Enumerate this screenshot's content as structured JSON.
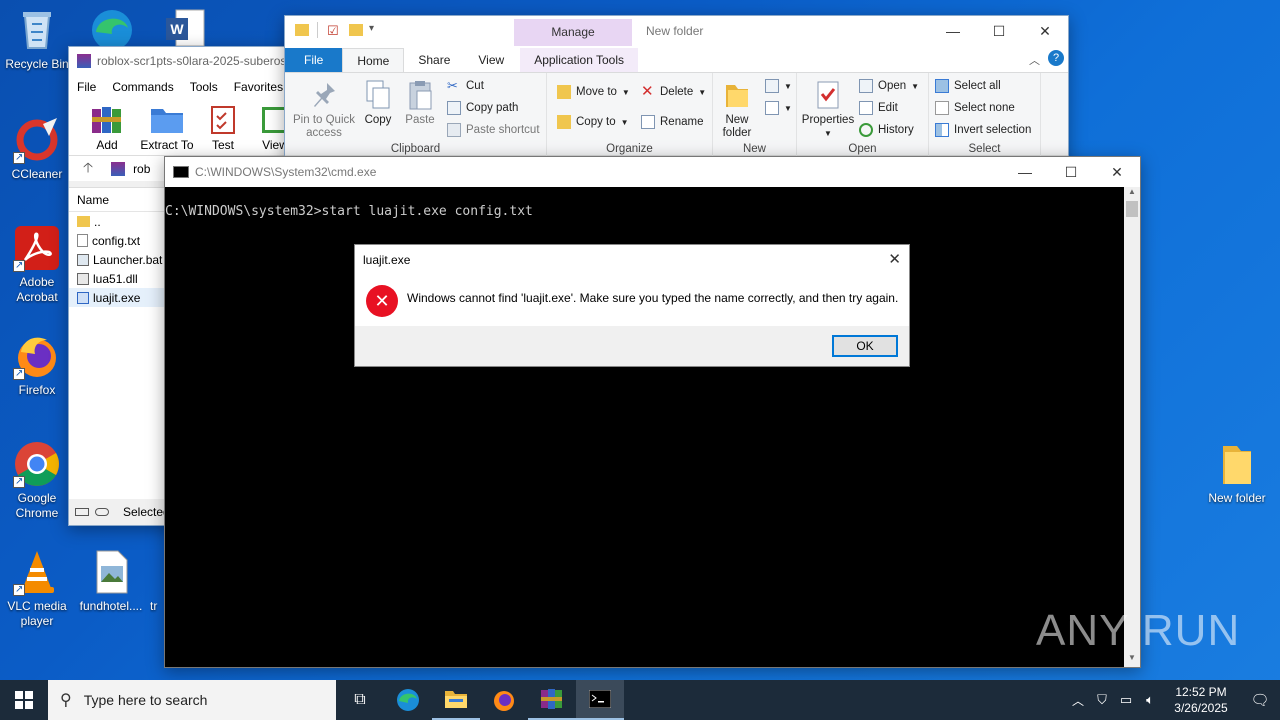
{
  "desktop": {
    "icons": [
      {
        "label": "Recycle Bin"
      },
      {
        "label": "CCleaner"
      },
      {
        "label": "Adobe Acrobat"
      },
      {
        "label": "Firefox"
      },
      {
        "label": "Google Chrome"
      },
      {
        "label": "VLC media player"
      },
      {
        "label": "fundhotel...."
      },
      {
        "label": "tr"
      },
      {
        "label": "New folder"
      }
    ]
  },
  "winrar": {
    "title": "roblox-scr1pts-s0lara-2025-suberos",
    "menu": [
      "File",
      "Commands",
      "Tools",
      "Favorites"
    ],
    "toolbar": [
      "Add",
      "Extract To",
      "Test",
      "View"
    ],
    "path_text": "rob",
    "column_name": "Name",
    "files": [
      "..",
      "config.txt",
      "Launcher.bat",
      "lua51.dll",
      "luajit.exe"
    ],
    "status": "Selected"
  },
  "explorer": {
    "title": "New folder",
    "manage_tab": "Manage",
    "tabs": [
      "File",
      "Home",
      "Share",
      "View",
      "Application Tools"
    ],
    "clipboard": {
      "pin": "Pin to Quick access",
      "copy": "Copy",
      "paste": "Paste",
      "cut": "Cut",
      "copy_path": "Copy path",
      "paste_shortcut": "Paste shortcut",
      "label": "Clipboard"
    },
    "organize": {
      "move_to": "Move to",
      "copy_to": "Copy to",
      "delete": "Delete",
      "rename": "Rename",
      "label": "Organize"
    },
    "new": {
      "new_folder": "New folder",
      "label": "New"
    },
    "open": {
      "properties": "Properties",
      "open": "Open",
      "edit": "Edit",
      "history": "History",
      "label": "Open"
    },
    "select": {
      "select_all": "Select all",
      "select_none": "Select none",
      "invert": "Invert selection",
      "label": "Select"
    }
  },
  "cmd": {
    "title": "C:\\WINDOWS\\System32\\cmd.exe",
    "line": "C:\\WINDOWS\\system32>start luajit.exe config.txt"
  },
  "dialog": {
    "title": "luajit.exe",
    "message": "Windows cannot find 'luajit.exe'. Make sure you typed the name correctly, and then try again.",
    "ok": "OK"
  },
  "taskbar": {
    "search_placeholder": "Type here to search",
    "time": "12:52 PM",
    "date": "3/26/2025"
  },
  "watermark": "ANY RUN"
}
